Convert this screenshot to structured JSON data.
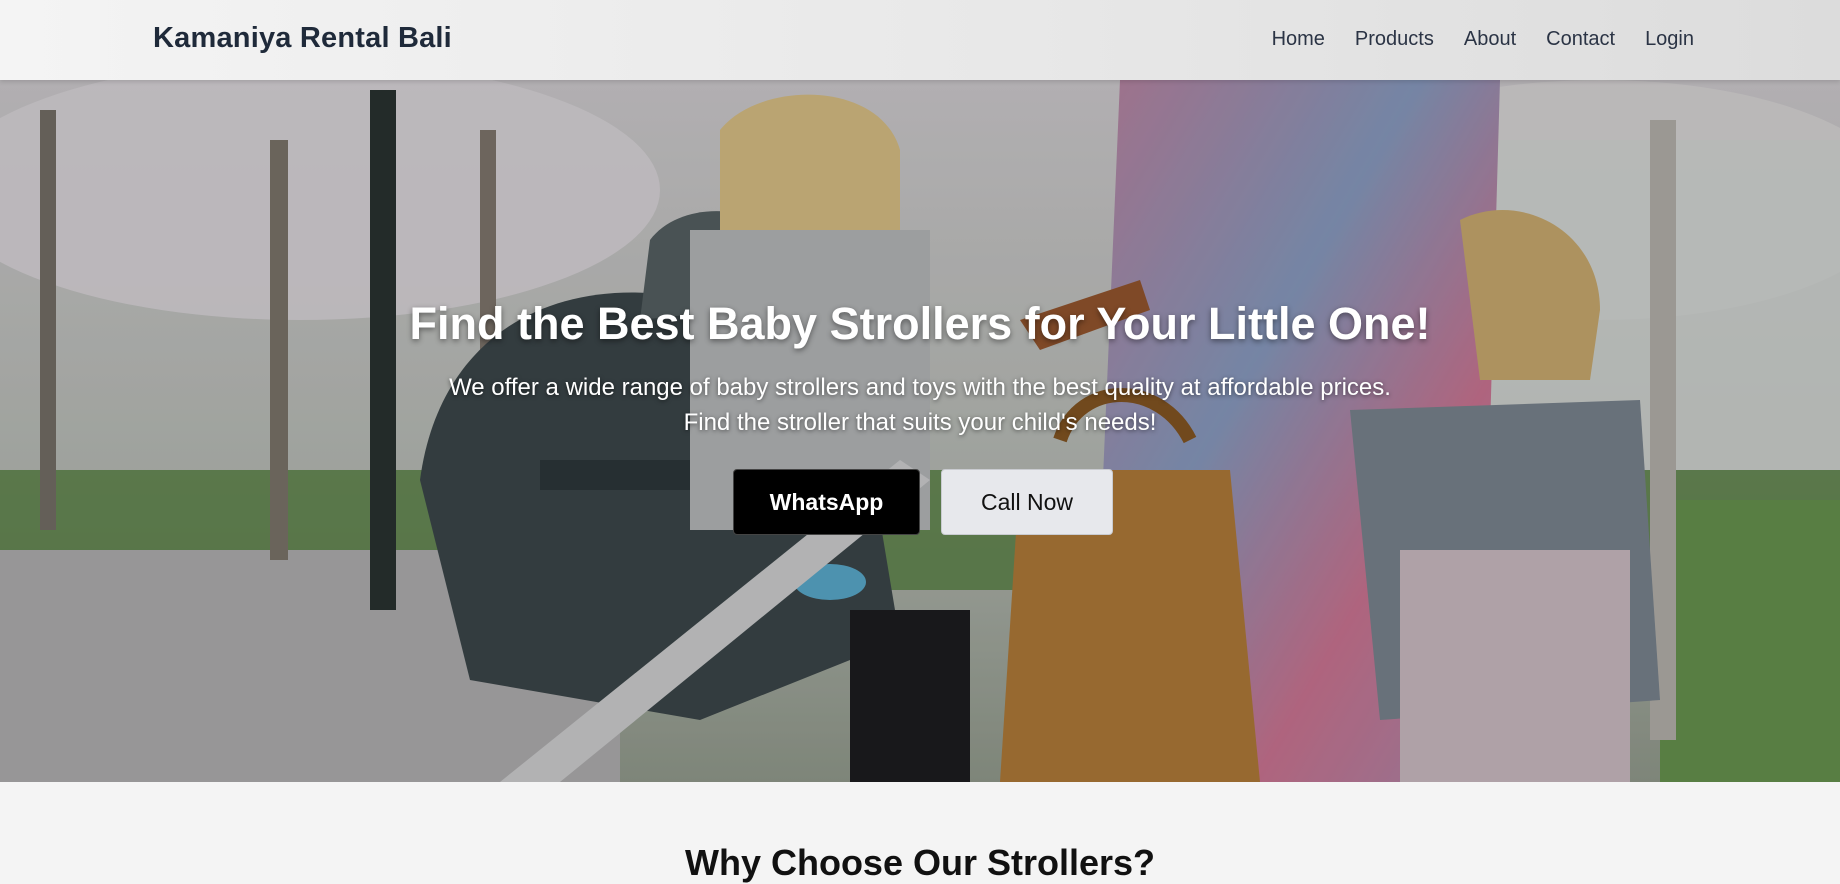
{
  "header": {
    "brand": "Kamaniya Rental Bali",
    "nav": [
      "Home",
      "Products",
      "About",
      "Contact",
      "Login"
    ]
  },
  "hero": {
    "title": "Find the Best Baby Strollers for Your Little One!",
    "text": "We offer a wide range of baby strollers and toys with the best quality at affordable prices. Find the stroller that suits your child's needs!",
    "whatsapp_label": "WhatsApp",
    "call_label": "Call Now"
  },
  "features": {
    "title": "Why Choose Our Strollers?"
  },
  "colors": {
    "brand_text": "#1f2a3a",
    "whatsapp_button": "#000000",
    "call_button": "#e7e8ec"
  }
}
